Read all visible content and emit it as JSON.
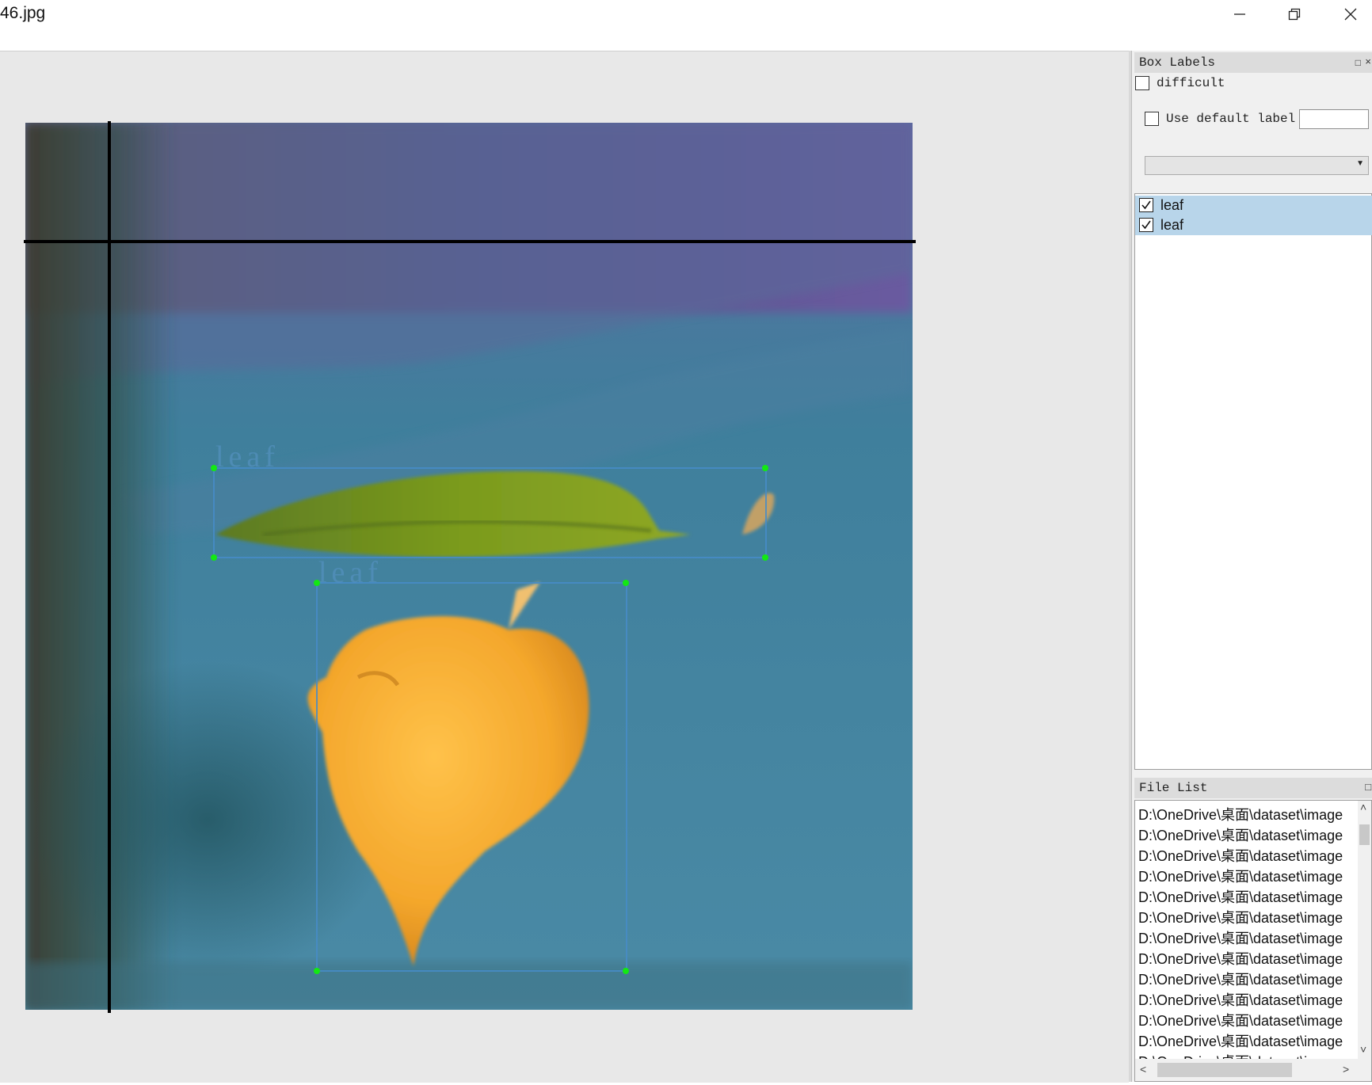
{
  "window": {
    "title": "46.jpg",
    "controls": [
      "minimize",
      "restore",
      "close"
    ]
  },
  "canvas": {
    "annotations": [
      {
        "label": "leaf"
      },
      {
        "label": "leaf"
      }
    ]
  },
  "box_labels_panel": {
    "title": "Box Labels",
    "difficult_label": "difficult",
    "difficult_checked": false,
    "use_default_label": "Use default label",
    "use_default_checked": false,
    "default_label_value": "",
    "combo_value": "",
    "labels": [
      {
        "text": "leaf",
        "checked": true
      },
      {
        "text": "leaf",
        "checked": true
      }
    ]
  },
  "file_list_panel": {
    "title": "File List",
    "files": [
      "D:\\OneDrive\\桌面\\dataset\\image",
      "D:\\OneDrive\\桌面\\dataset\\image",
      "D:\\OneDrive\\桌面\\dataset\\image",
      "D:\\OneDrive\\桌面\\dataset\\image",
      "D:\\OneDrive\\桌面\\dataset\\image",
      "D:\\OneDrive\\桌面\\dataset\\image",
      "D:\\OneDrive\\桌面\\dataset\\image",
      "D:\\OneDrive\\桌面\\dataset\\image",
      "D:\\OneDrive\\桌面\\dataset\\image",
      "D:\\OneDrive\\桌面\\dataset\\image",
      "D:\\OneDrive\\桌面\\dataset\\image",
      "D:\\OneDrive\\桌面\\dataset\\image",
      "D:\\OneDrive\\桌面\\dataset\\image"
    ]
  },
  "colors": {
    "selection": "#b8d5ea",
    "bbox": "#468cc8",
    "handle": "#13e813"
  }
}
